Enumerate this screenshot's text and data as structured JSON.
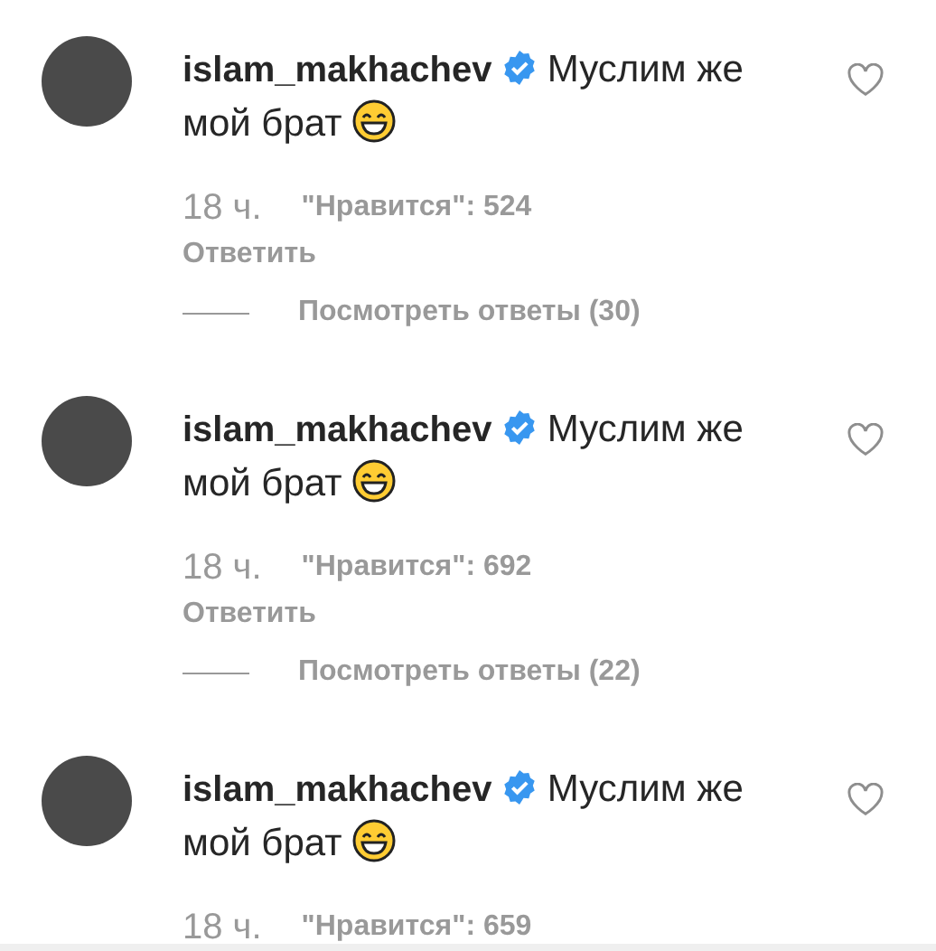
{
  "comments": [
    {
      "username": "islam_makhachev",
      "verified": true,
      "text": "Муслим же мой брат",
      "liked": false,
      "time": "18 ч.",
      "likes": "\"Нравится\": 524",
      "reply": "Ответить",
      "view_replies": "Посмотреть ответы (30)"
    },
    {
      "username": "islam_makhachev",
      "verified": true,
      "text": "Муслим же мой брат",
      "liked": false,
      "time": "18 ч.",
      "likes": "\"Нравится\": 692",
      "reply": "Ответить",
      "view_replies": "Посмотреть ответы (22)"
    },
    {
      "username": "islam_makhachev",
      "verified": true,
      "text": "Муслим же мой брат",
      "liked": false,
      "time": "18 ч.",
      "likes": "\"Нравится\": 659"
    }
  ]
}
